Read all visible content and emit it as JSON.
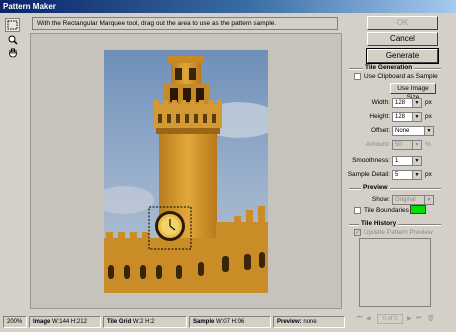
{
  "window": {
    "title": "Pattern Maker"
  },
  "toolbar": {
    "tools": [
      {
        "name": "rectangular-marquee-tool",
        "icon": "marquee-icon",
        "active": true
      },
      {
        "name": "zoom-tool",
        "icon": "zoom-icon",
        "active": false
      },
      {
        "name": "hand-tool",
        "icon": "hand-icon",
        "active": false
      }
    ]
  },
  "hint": "With the Rectangular Marquee tool, drag out the area to use as the pattern sample.",
  "buttons": {
    "ok": "OK",
    "cancel": "Cancel",
    "generate": "Generate"
  },
  "tile_generation": {
    "title": "Tile Generation",
    "use_clipboard_label": "Use Clipboard as Sample",
    "use_clipboard_checked": false,
    "use_image_size": "Use Image Size",
    "width_label": "Width:",
    "width_value": "128",
    "width_unit": "px",
    "height_label": "Height:",
    "height_value": "128",
    "height_unit": "px",
    "offset_label": "Offset:",
    "offset_value": "None",
    "amount_label": "Amount:",
    "amount_value": "50",
    "amount_unit": "%",
    "smoothness_label": "Smoothness:",
    "smoothness_value": "1",
    "sample_detail_label": "Sample Detail:",
    "sample_detail_value": "5",
    "sample_detail_unit": "px"
  },
  "preview": {
    "title": "Preview",
    "show_label": "Show:",
    "show_value": "Original",
    "tile_boundaries_label": "Tile Boundaries",
    "tile_boundaries_checked": false,
    "boundary_color": "#00e000"
  },
  "tile_history": {
    "title": "Tile History",
    "update_label": "Update Pattern Preview",
    "update_checked": true,
    "counter": "0 of 0"
  },
  "status": {
    "zoom": "200%",
    "image_label": "Image",
    "image_value": "W:144 H:212",
    "tile_grid_label": "Tile Grid",
    "tile_grid_value": "W:2 H:2",
    "sample_label": "Sample",
    "sample_value": "W:07 H:06",
    "preview_label": "Preview:",
    "preview_value": "none"
  },
  "colors": {
    "panel": "#d4d0c8",
    "title_bar": "#0a246a",
    "selection": "#000000"
  }
}
